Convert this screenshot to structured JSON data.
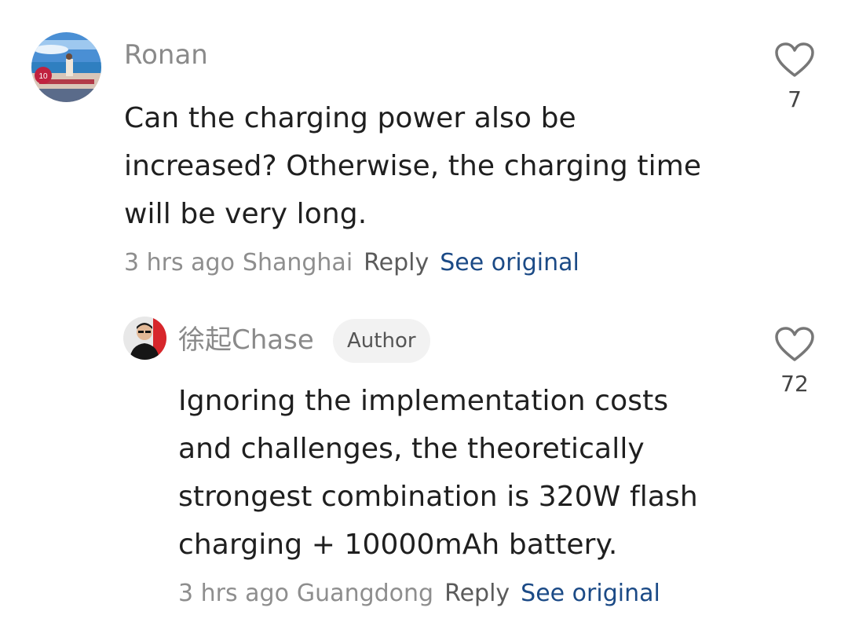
{
  "comments": [
    {
      "username": "Ronan",
      "avatar_icon": "avatar-photo-beach",
      "text": "Can the charging power also be increased? Otherwise, the charging time will be very long.",
      "time": "3 hrs ago",
      "location": "Shanghai",
      "reply_label": "Reply",
      "see_original_label": "See original",
      "likes": "7"
    }
  ],
  "reply": {
    "username": "徐起Chase",
    "badge": "Author",
    "avatar_icon": "avatar-photo-man",
    "text": "Ignoring the implementation costs and challenges, the theoretically strongest combination is 320W flash charging + 10000mAh battery.",
    "time": "3 hrs ago",
    "location": "Guangdong",
    "reply_label": "Reply",
    "see_original_label": "See original",
    "likes": "72"
  },
  "colors": {
    "username": "#8a8a8a",
    "link": "#1b4a86",
    "text": "#1f1f1f",
    "badge_bg": "#f2f2f2"
  }
}
